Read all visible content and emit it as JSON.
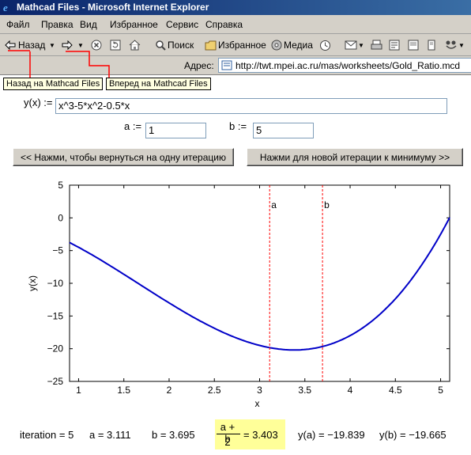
{
  "window": {
    "title": "Mathcad Files - Microsoft Internet Explorer"
  },
  "menu": [
    "Файл",
    "Правка",
    "Вид",
    "Избранное",
    "Сервис",
    "Справка"
  ],
  "toolbar": {
    "back": "Назад",
    "search": "Поиск",
    "favorites": "Избранное",
    "media": "Медиа"
  },
  "address": {
    "label": "Адрес:",
    "url": "http://twt.mpei.ac.ru/mas/worksheets/Gold_Ratio.mcd"
  },
  "tooltips": {
    "back": "Назад на Mathcad Files",
    "forward": "Вперед на Mathcad Files"
  },
  "form": {
    "function_label": "y(x) :=",
    "function_value": "x^3-5*x^2-0.5*x",
    "a_label": "a :=",
    "a_value": "1",
    "b_label": "b :=",
    "b_value": "5",
    "back_button": "<< Нажми, чтобы вернуться на одну итерацию",
    "next_button": "Нажми для новой итерации к минимуму >>"
  },
  "chart_data": {
    "type": "line",
    "function": "y(x) = x^3 - 5*x^2 - 0.5*x",
    "xlabel": "x",
    "ylabel": "y(x)",
    "xlim": [
      0.9,
      5.1
    ],
    "ylim": [
      -25,
      5
    ],
    "xticks": [
      "1",
      "1.5",
      "2",
      "2.5",
      "3",
      "3.5",
      "4",
      "4.5",
      "5"
    ],
    "yticks": [
      "5",
      "0",
      "-5",
      "-10",
      "-15",
      "-20",
      "-25"
    ],
    "markers": [
      {
        "name": "a",
        "x": 3.111
      },
      {
        "name": "b",
        "x": 3.695
      }
    ],
    "series_color": "#0000c8",
    "marker_color": "#ff0000"
  },
  "results": {
    "iteration": "iteration = 5",
    "a": "a = 3.111",
    "b": "b = 3.695",
    "mid_num": "a + b",
    "mid_den": "2",
    "mid_val": "= 3.403",
    "ya": "y(a) = −19.839",
    "yb": "y(b) = −19.665"
  }
}
